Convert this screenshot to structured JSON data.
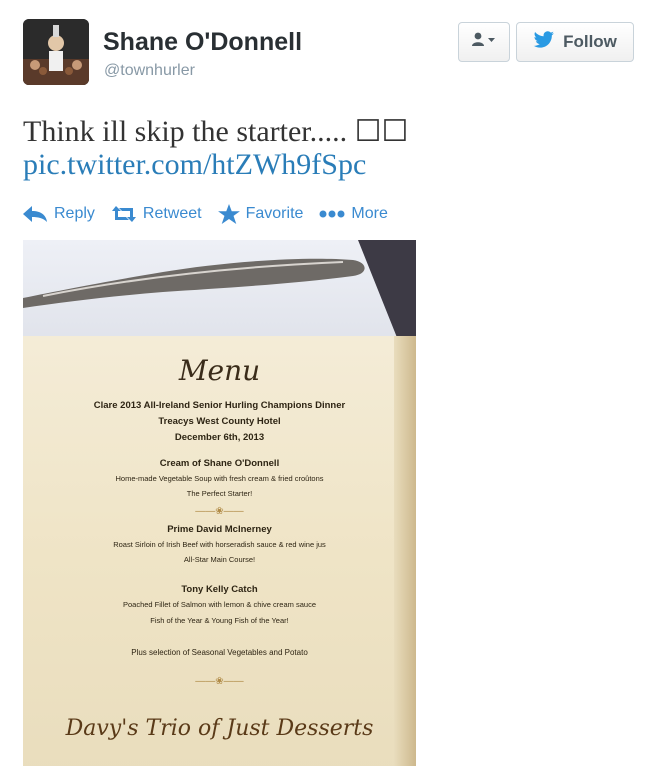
{
  "user": {
    "name": "Shane O'Donnell",
    "handle": "@townhurler"
  },
  "header": {
    "user_menu_icon": "user-dropdown-icon",
    "follow_label": "Follow",
    "follow_icon": "twitter-bird-icon"
  },
  "tweet": {
    "text": "Think ill skip the starter..... ☐☐",
    "link": "pic.twitter.com/htZWh9fSpc"
  },
  "actions": [
    {
      "label": "Reply",
      "icon": "reply-icon"
    },
    {
      "label": "Retweet",
      "icon": "retweet-icon"
    },
    {
      "label": "Favorite",
      "icon": "star-icon"
    },
    {
      "label": "More",
      "icon": "more-dots-icon"
    }
  ],
  "colors": {
    "link": "#2a7db8",
    "action": "#3a8ad0",
    "name": "#292f33",
    "handle": "#8899a6"
  },
  "photo_menu": {
    "title": "Menu",
    "event_lines": [
      "Clare 2013 All-Ireland Senior Hurling Champions Dinner",
      "Treacys West County Hotel",
      "December 6th, 2013"
    ],
    "courses": [
      {
        "name": "Cream of Shane O'Donnell",
        "description": "Home-made Vegetable Soup with fresh cream & fried croûtons",
        "subtitle": "The Perfect Starter!"
      },
      {
        "name": "Prime David McInerney",
        "description": "Roast Sirloin of Irish Beef with horseradish sauce & red wine jus",
        "subtitle": "All-Star Main Course!"
      },
      {
        "name": "Tony Kelly Catch",
        "description": "Poached Fillet of Salmon with lemon & chive cream sauce",
        "subtitle": "Fish of the Year & Young Fish of the Year!"
      }
    ],
    "sides": "Plus selection of Seasonal Vegetables and Potato",
    "dessert": "Davy's Trio of Just Desserts"
  }
}
